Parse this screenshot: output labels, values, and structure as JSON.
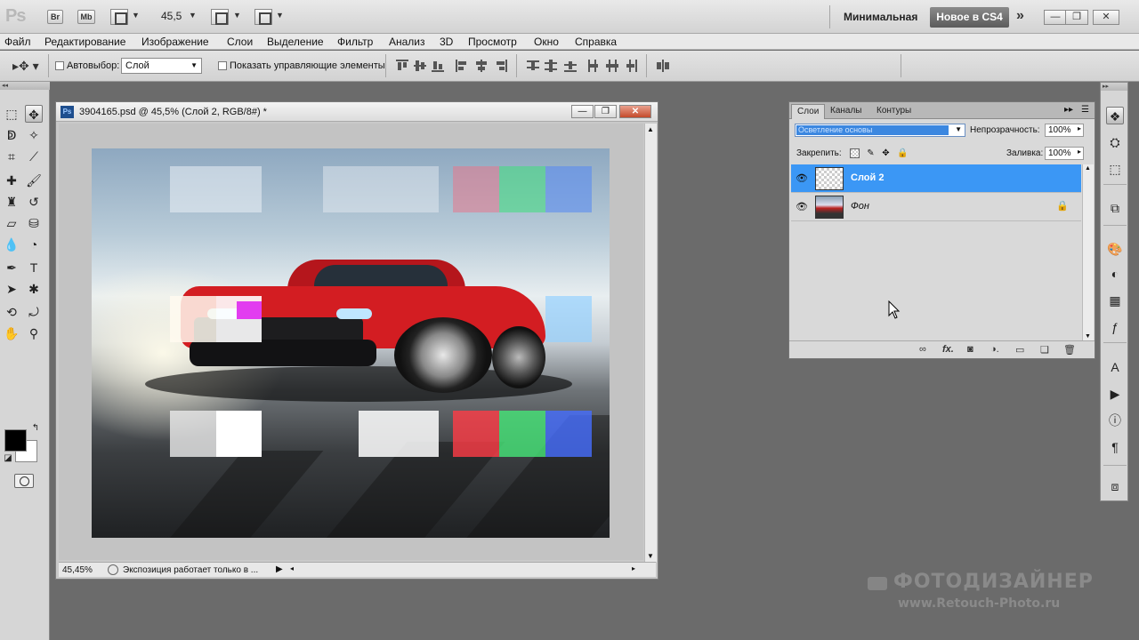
{
  "appbar": {
    "logo": "Ps",
    "bridge": "Br",
    "minibridge": "Mb",
    "zoom": "45,5",
    "workspace_min": "Минимальная",
    "workspace_new": "Новое в CS4",
    "more": "»"
  },
  "menu": [
    "Файл",
    "Редактирование",
    "Изображение",
    "Слои",
    "Выделение",
    "Фильтр",
    "Анализ",
    "3D",
    "Просмотр",
    "Окно",
    "Справка"
  ],
  "options": {
    "auto_select_label": "Автовыбор:",
    "auto_select_value": "Слой",
    "show_controls_label": "Показать управляющие элементы"
  },
  "document": {
    "ps_badge": "Ps",
    "title": "3904165.psd @ 45,5% (Слой 2, RGB/8#) *",
    "status_zoom": "45,45%",
    "status_info": "Экспозиция работает только в ..."
  },
  "layers_panel": {
    "tabs": [
      "Слои",
      "Каналы",
      "Контуры"
    ],
    "blend_mode": "Осветление основы",
    "opacity_label": "Непрозрачность:",
    "opacity_value": "100%",
    "lock_label": "Закрепить:",
    "fill_label": "Заливка:",
    "fill_value": "100%",
    "layers": [
      {
        "name": "Слой 2",
        "selected": true
      },
      {
        "name": "Фон",
        "selected": false,
        "locked": true
      }
    ]
  },
  "watermark": {
    "brand": "ФОТОДИЗАЙНЕР",
    "url": "www.Retouch-Photo.ru"
  },
  "colors": {
    "accent": "#3b97f5",
    "car_red": "#d31d22",
    "workspace_bg": "#6b6b6b"
  }
}
